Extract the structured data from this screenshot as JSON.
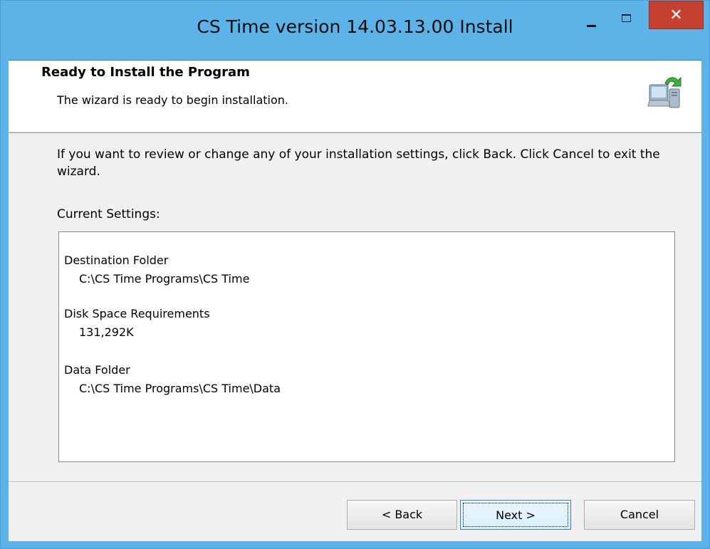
{
  "window": {
    "title": "CS Time version 14.03.13.00 Install",
    "close_glyph": "✕"
  },
  "header": {
    "title": "Ready to Install the Program",
    "subtitle": "The wizard is ready to begin installation.",
    "icon": "computer-install-icon"
  },
  "body": {
    "intro": "If you want to review or change any of your installation settings, click Back. Click Cancel to exit the wizard.",
    "settings_label": "Current Settings:"
  },
  "settings": [
    {
      "label": "Destination Folder",
      "value": "C:\\CS Time Programs\\CS Time"
    },
    {
      "label": "Disk Space Requirements",
      "value": "131,292K"
    },
    {
      "label": "Data Folder",
      "value": "C:\\CS Time Programs\\CS Time\\Data"
    }
  ],
  "buttons": {
    "back": "< Back",
    "next": "Next >",
    "cancel": "Cancel"
  },
  "colors": {
    "titlebar": "#5bb3e8",
    "close": "#c6402f"
  }
}
